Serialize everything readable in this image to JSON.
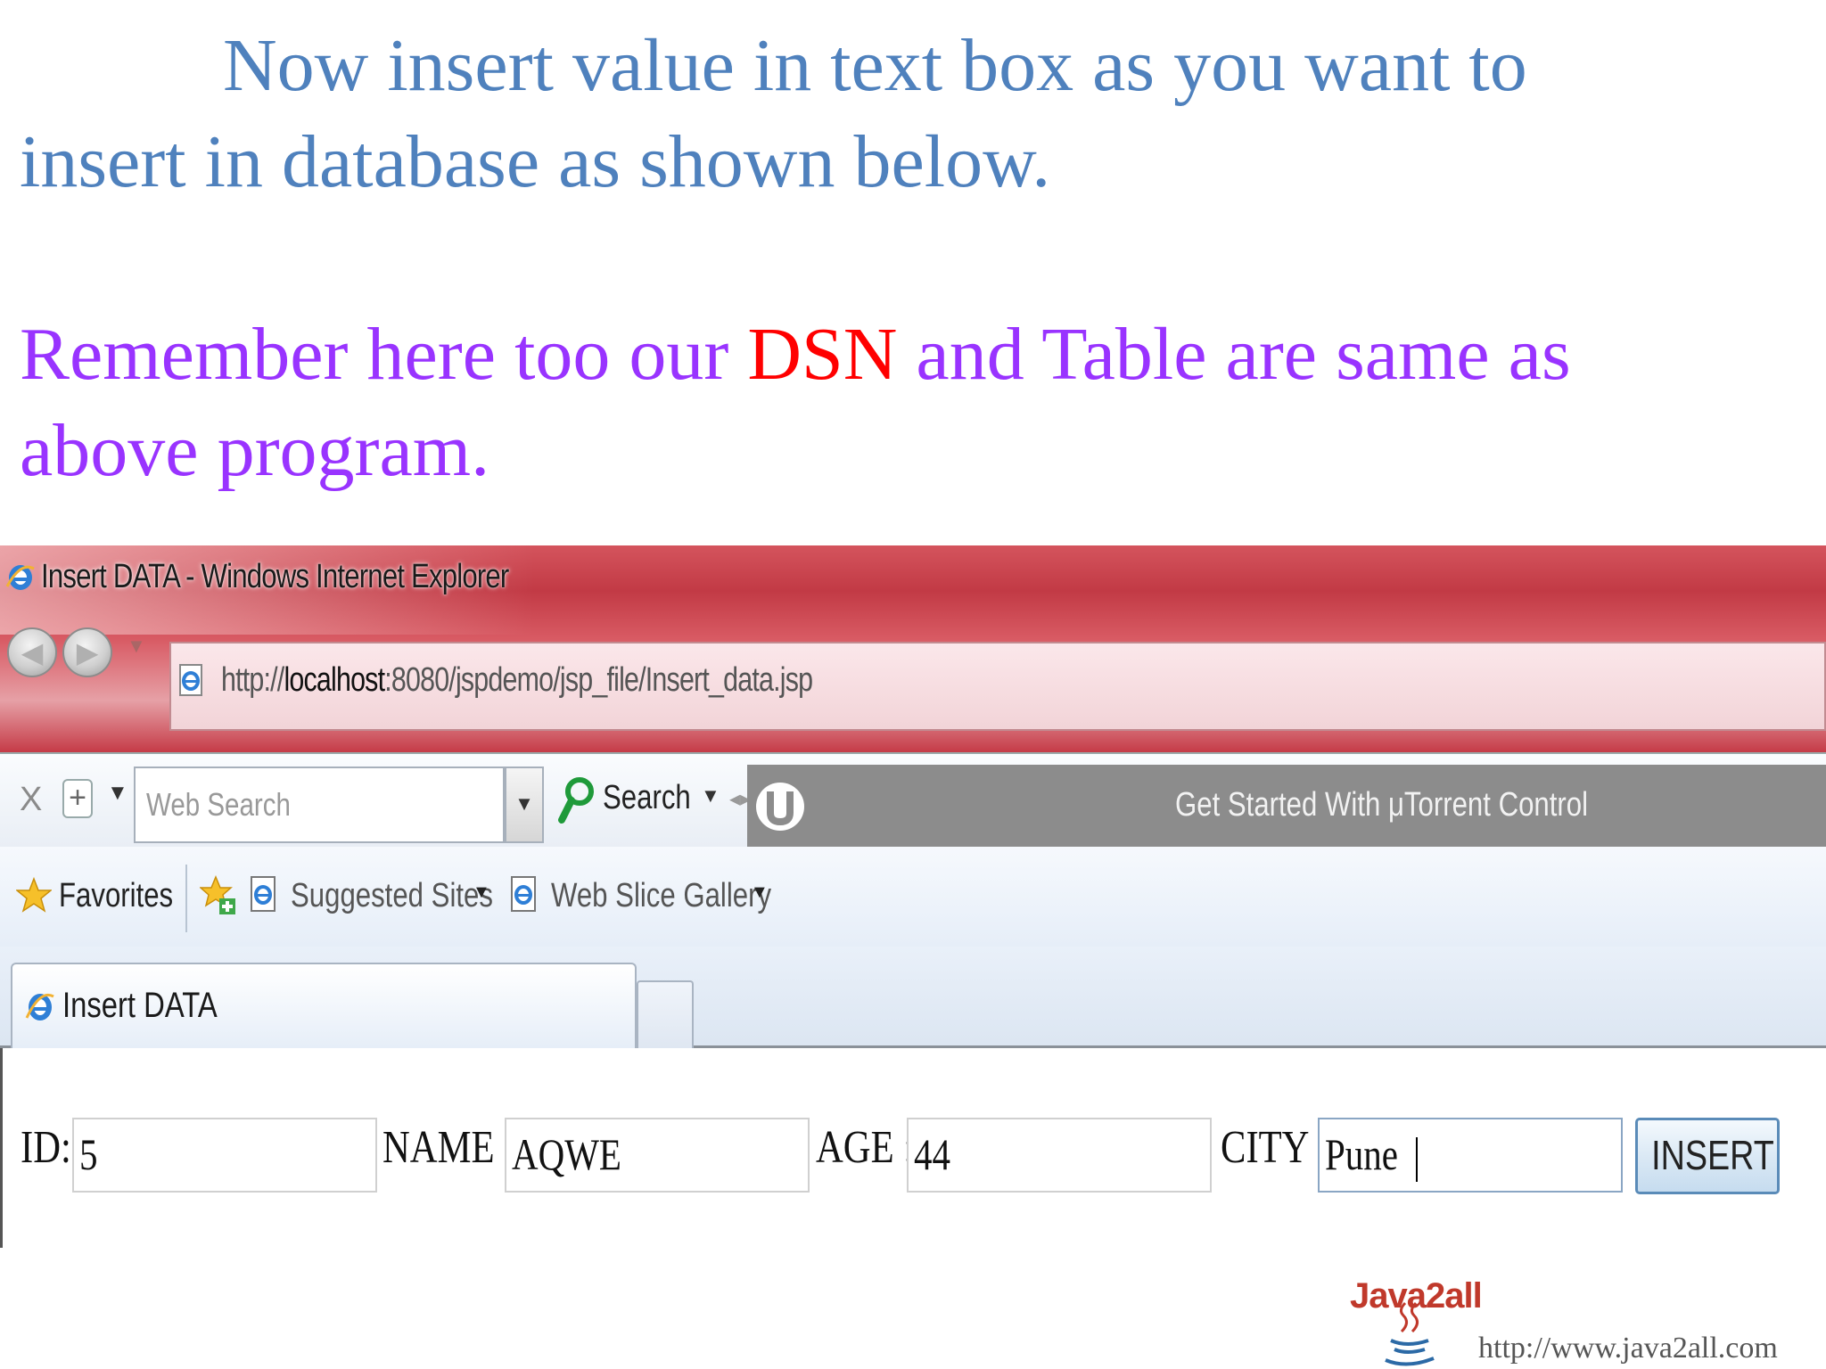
{
  "slide": {
    "para1": {
      "line1": "Now insert value in text box as you want to",
      "line2": "insert in database as shown below."
    },
    "para2": {
      "part1": "Remember here too our ",
      "highlight": "DSN",
      "part2": " and Table are same as",
      "line2": "above program."
    }
  },
  "browser": {
    "title": "Insert DATA - Windows Internet Explorer",
    "address": {
      "prefix": "http://",
      "host": "localhost",
      "rest": ":8080/jspdemo/jsp_file/Insert_data.jsp"
    },
    "toolbar": {
      "close": "X",
      "add": "+",
      "search_placeholder": "Web Search",
      "search_label": "Search",
      "utorrent_text": "Get Started With μTorrent Control"
    },
    "favorites": {
      "label": "Favorites",
      "suggested": "Suggested Sites",
      "webslice": "Web Slice Gallery"
    },
    "tab": {
      "label": "Insert DATA"
    }
  },
  "form": {
    "id_label": "ID:",
    "id_value": "5",
    "name_label": "NAME :",
    "name_value": "AQWE",
    "age_label": "AGE :",
    "age_value": "44",
    "city_label": "CITY :",
    "city_value": "Pune",
    "insert_label": "INSERT"
  },
  "footer": {
    "logo_text": "Java2all",
    "url": "http://www.java2all.com"
  },
  "colors": {
    "para1": "#4f81bd",
    "para2": "#9933ff",
    "highlight": "#ff0000"
  }
}
